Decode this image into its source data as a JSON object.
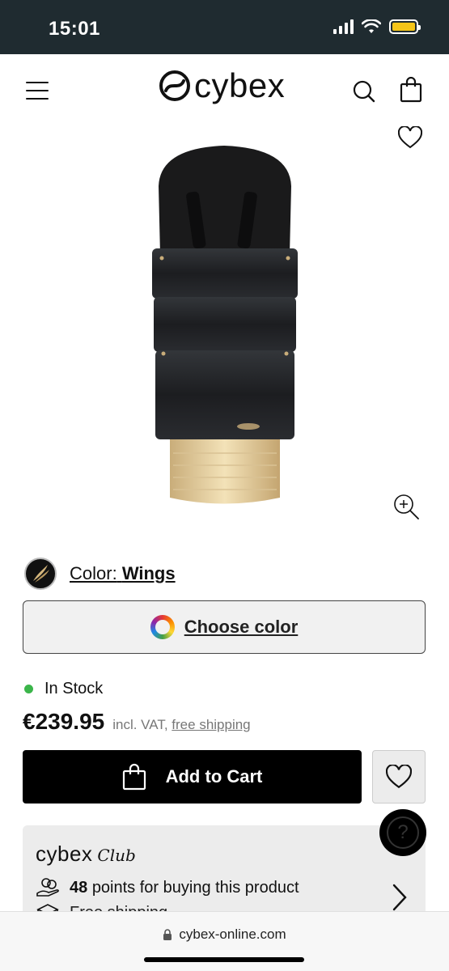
{
  "status_bar": {
    "time": "15:01",
    "battery_color": "#f5c518"
  },
  "header": {
    "logo_text": "cybex",
    "icons": [
      "menu-icon",
      "search-icon",
      "shopping-bag-icon"
    ]
  },
  "product": {
    "color_label": "Color:",
    "color_value": "Wings",
    "choose_color_label": "Choose color",
    "stock_text": "In Stock",
    "stock_color": "#3bb54a",
    "price": "€239.95",
    "price_vat": "incl. VAT,",
    "price_shipping": "free shipping",
    "add_to_cart_label": "Add to Cart"
  },
  "club": {
    "logo_main": "cybex",
    "logo_sub": "Club",
    "points_value": "48",
    "points_text": "points for buying this product",
    "second_line": "Free shipping"
  },
  "browser": {
    "url": "cybex-online.com"
  }
}
